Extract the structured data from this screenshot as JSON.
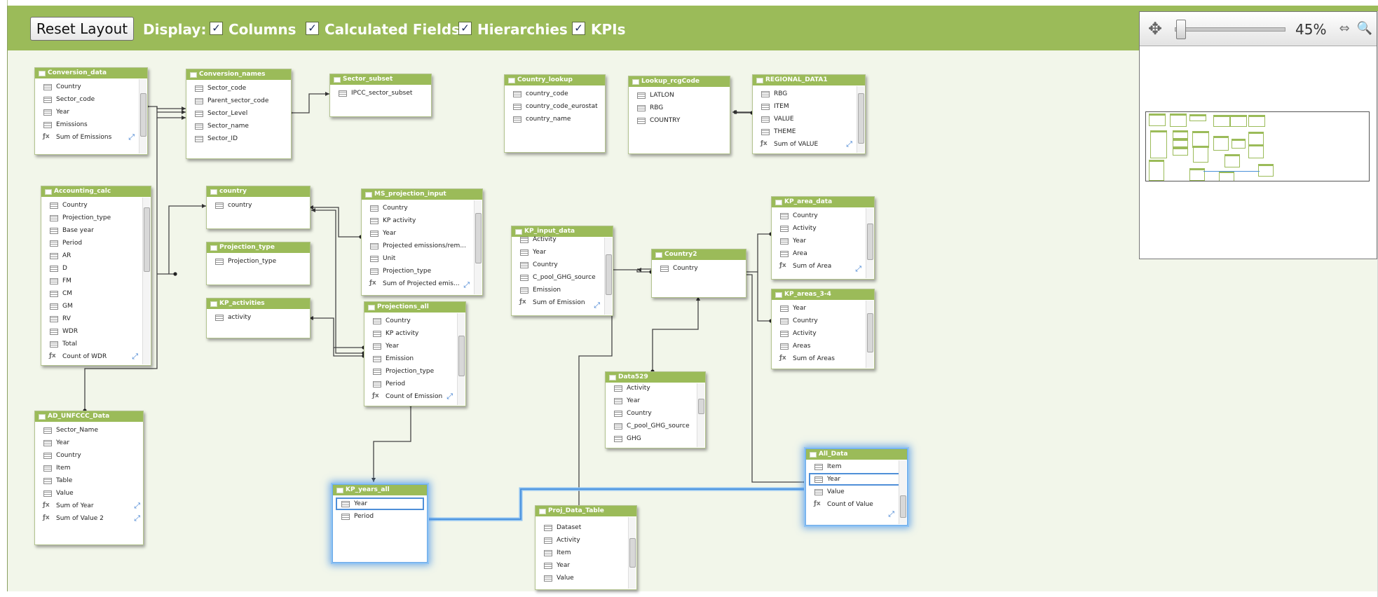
{
  "toolbar": {
    "reset_label": "Reset Layout",
    "display_label": "Display:",
    "options": [
      {
        "label": "Columns",
        "checked": true
      },
      {
        "label": "Calculated Fields",
        "checked": true
      },
      {
        "label": "Hierarchies",
        "checked": true
      },
      {
        "label": "KPIs",
        "checked": true
      }
    ],
    "check_glyph": "✓"
  },
  "zoom": {
    "percent": "45%",
    "level": 0.45
  },
  "tables": {
    "conversion_data": {
      "title": "Conversion_data",
      "rows": [
        "Country",
        "Sector_code",
        "Year",
        "Emissions",
        "Sum of Emissions"
      ]
    },
    "conversion_names": {
      "title": "Conversion_names",
      "rows": [
        "Sector_code",
        "Parent_sector_code",
        "Sector_Level",
        "Sector_name",
        "Sector_ID"
      ]
    },
    "sector_subset": {
      "title": "Sector_subset",
      "rows": [
        "IPCC_sector_subset"
      ]
    },
    "country_lookup": {
      "title": "Country_lookup",
      "rows": [
        "country_code",
        "country_code_eurostat",
        "country_name"
      ]
    },
    "lookup_rcgcode": {
      "title": "Lookup_rcgCode",
      "rows": [
        "LATLON",
        "RBG",
        "COUNTRY"
      ]
    },
    "regional_data1": {
      "title": "REGIONAL_DATA1",
      "rows": [
        "RBG",
        "ITEM",
        "VALUE",
        "THEME",
        "Sum of VALUE"
      ]
    },
    "accounting_calc": {
      "title": "Accounting_calc",
      "rows": [
        "Country",
        "Projection_type",
        "Base year",
        "Period",
        "AR",
        "D",
        "FM",
        "CM",
        "GM",
        "RV",
        "WDR",
        "Total",
        "Count of WDR"
      ]
    },
    "country": {
      "title": "country",
      "rows": [
        "country"
      ]
    },
    "projection_type": {
      "title": "Projection_type",
      "rows": [
        "Projection_type"
      ]
    },
    "kp_activities": {
      "title": "KP_activities",
      "rows": [
        "activity"
      ]
    },
    "ms_projection_input": {
      "title": "MS_projection_input",
      "rows": [
        "Country",
        "KP activity",
        "Year",
        "Projected emissions/rem...",
        "Unit",
        "Projection_type",
        "Sum of Projected emis..."
      ]
    },
    "projections_all": {
      "title": "Projections_all",
      "rows": [
        "Country",
        "KP activity",
        "Year",
        "Emission",
        "Projection_type",
        "Period",
        "Count of Emission"
      ]
    },
    "kp_input_data": {
      "title": "KP_input_data",
      "rows": [
        "Activity",
        "Year",
        "Country",
        "C_pool_GHG_source",
        "Emission",
        "Sum of Emission"
      ]
    },
    "country2": {
      "title": "Country2",
      "rows": [
        "Country"
      ]
    },
    "kp_area_data": {
      "title": "KP_area_data",
      "rows": [
        "Country",
        "Activity",
        "Year",
        "Area",
        "Sum of Area"
      ]
    },
    "kp_areas_3_4": {
      "title": "KP_areas_3-4",
      "rows": [
        "Year",
        "Country",
        "Activity",
        "Areas",
        "Sum of Areas"
      ]
    },
    "data529": {
      "title": "Data529",
      "rows": [
        "Activity",
        "Year",
        "Country",
        "C_pool_GHG_source",
        "GHG"
      ]
    },
    "ad_unfccc_data": {
      "title": "AD_UNFCCC_Data",
      "rows": [
        "Sector_Name",
        "Year",
        "Country",
        "Item",
        "Table",
        "Value",
        "Sum of Year",
        "Sum of Value 2"
      ]
    },
    "kp_years_all": {
      "title": "KP_years_all",
      "rows": [
        "Year",
        "Period"
      ]
    },
    "proj_data_table": {
      "title": "Proj_Data_Table",
      "rows": [
        "Dataset",
        "Activity",
        "Item",
        "Year",
        "Value"
      ]
    },
    "all_data": {
      "title": "All_Data",
      "rows": [
        "Item",
        "Year",
        "Value",
        "Count of Value"
      ]
    }
  }
}
